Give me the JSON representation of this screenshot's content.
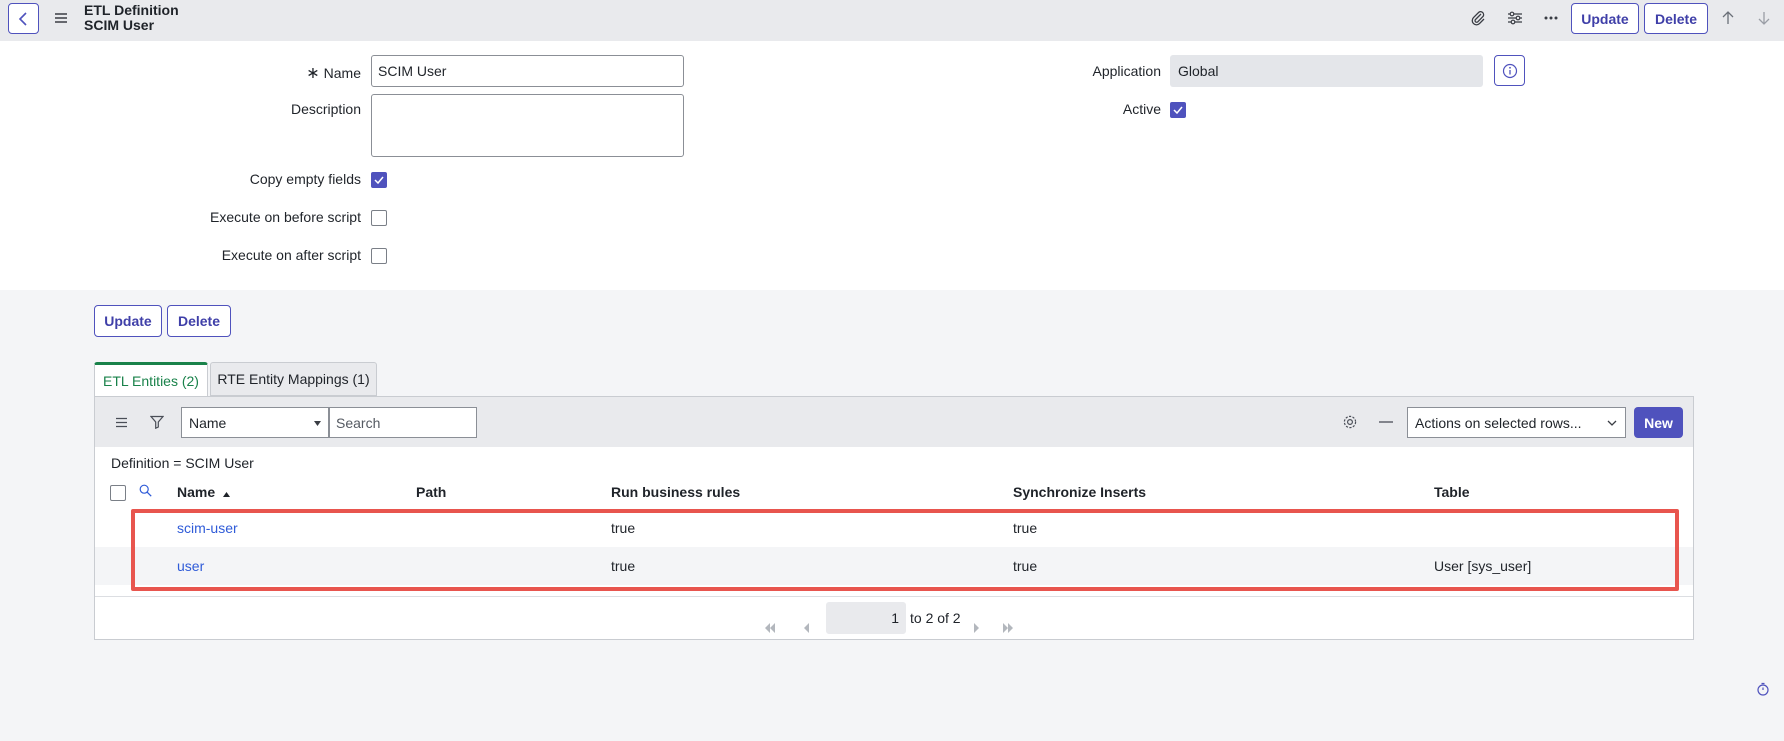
{
  "header": {
    "title_line1": "ETL Definition",
    "title_line2": "SCIM User",
    "update_label": "Update",
    "delete_label": "Delete"
  },
  "form": {
    "name_label": "Name",
    "name_value": "SCIM User",
    "description_label": "Description",
    "description_value": "",
    "copy_empty_label": "Copy empty fields",
    "copy_empty_checked": true,
    "exec_before_label": "Execute on before script",
    "exec_before_checked": false,
    "exec_after_label": "Execute on after script",
    "exec_after_checked": false,
    "application_label": "Application",
    "application_value": "Global",
    "active_label": "Active",
    "active_checked": true
  },
  "buttons": {
    "update_label": "Update",
    "delete_label": "Delete"
  },
  "tabs": [
    {
      "label": "ETL Entities (2)",
      "active": true
    },
    {
      "label": "RTE Entity Mappings (1)",
      "active": false
    }
  ],
  "list": {
    "field_select": "Name",
    "search_placeholder": "Search",
    "actions_select": "Actions on selected rows...",
    "new_label": "New",
    "breadcrumb": "Definition = SCIM User",
    "columns": [
      "Name",
      "Path",
      "Run business rules",
      "Synchronize Inserts",
      "Table"
    ],
    "rows": [
      {
        "name": "scim-user",
        "path": "",
        "run_business_rules": "true",
        "synchronize_inserts": "true",
        "table": ""
      },
      {
        "name": "user",
        "path": "",
        "run_business_rules": "true",
        "synchronize_inserts": "true",
        "table": "User [sys_user]"
      }
    ],
    "pager": {
      "current": "1",
      "range_text": "to 2 of 2"
    }
  },
  "colors": {
    "accent": "#4f52bd",
    "active_tab": "#19824a",
    "link": "#2f5bd8",
    "highlight": "#e8554e"
  }
}
